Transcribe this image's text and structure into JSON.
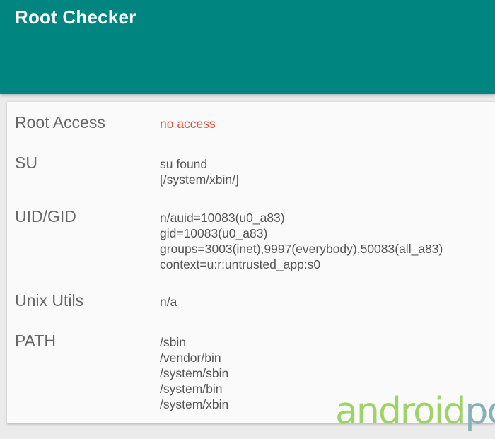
{
  "app": {
    "title": "Root Checker"
  },
  "rows": [
    {
      "label": "Root Access",
      "lines": [
        "no access"
      ],
      "alert": true
    },
    {
      "label": "SU",
      "lines": [
        "su found",
        "[/system/xbin/]"
      ]
    },
    {
      "label": "UID/GID",
      "lines": [
        "n/auid=10083(u0_a83)",
        "gid=10083(u0_a83)",
        "groups=3003(inet),9997(everybody),50083(all_a83)",
        "context=u:r:untrusted_app:s0"
      ]
    },
    {
      "label": "Unix Utils",
      "lines": [
        "n/a"
      ]
    },
    {
      "label": "PATH",
      "lines": [
        "/sbin",
        "/vendor/bin",
        "/system/sbin",
        "/system/bin",
        "/system/xbin"
      ]
    }
  ],
  "watermark": {
    "part1": "android",
    "part2": "pc"
  },
  "colors": {
    "appbar": "#008580",
    "alert": "#d9532c",
    "watermark_green": "#9fd367",
    "watermark_blue": "#88b2b8"
  }
}
